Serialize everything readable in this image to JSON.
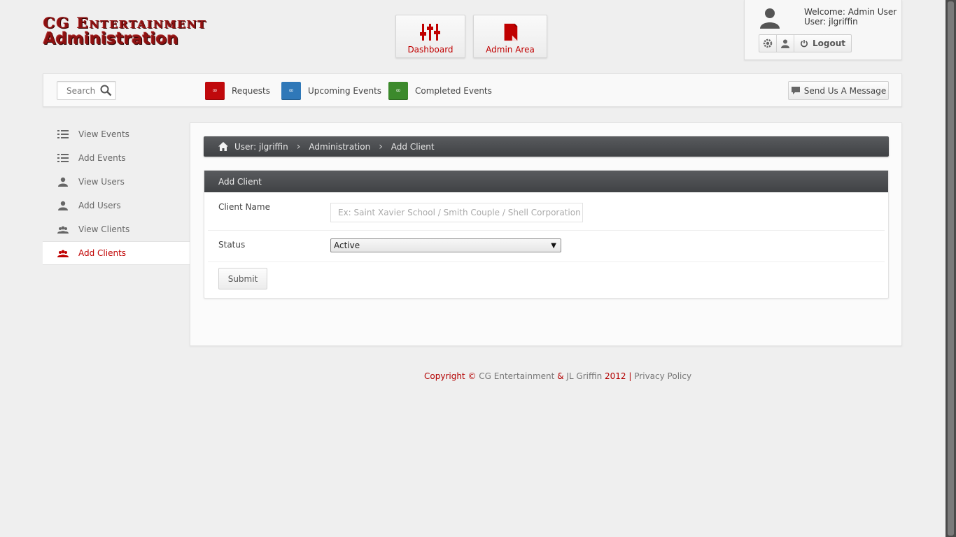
{
  "logo": {
    "top": "CG Entertainment",
    "bottom": "Administration"
  },
  "top_nav": {
    "dashboard": "Dashboard",
    "admin_area": "Admin Area"
  },
  "user": {
    "welcome": "Welcome: Admin User",
    "user_line": "User: jlgriffin",
    "logout": "Logout"
  },
  "toolbar": {
    "search_placeholder": "Search",
    "requests": "Requests",
    "upcoming": "Upcoming Events",
    "completed": "Completed Events",
    "send_message": "Send Us A Message",
    "requests_count": "∞",
    "upcoming_count": "∞",
    "completed_count": "∞",
    "colors": {
      "requests": "#c0090c",
      "upcoming": "#2f78b8",
      "completed": "#3c8a2c"
    }
  },
  "sidebar": {
    "items": [
      {
        "label": "View Events",
        "icon": "list-icon"
      },
      {
        "label": "Add Events",
        "icon": "list-icon"
      },
      {
        "label": "View Users",
        "icon": "user-icon"
      },
      {
        "label": "Add Users",
        "icon": "user-icon"
      },
      {
        "label": "View Clients",
        "icon": "group-icon"
      },
      {
        "label": "Add Clients",
        "icon": "group-icon",
        "active": true
      }
    ]
  },
  "breadcrumb": {
    "user": "User: jlgriffin",
    "section": "Administration",
    "page": "Add Client"
  },
  "form": {
    "title": "Add Client",
    "client_name_label": "Client Name",
    "client_name_placeholder": "Ex: Saint Xavier School / Smith Couple / Shell Corporation / Etc",
    "status_label": "Status",
    "status_value": "Active",
    "submit": "Submit"
  },
  "footer": {
    "copyright": "Copyright ©",
    "company": "CG Entertainment",
    "amp": "&",
    "person": "JL Griffin",
    "year": "2012",
    "sep": "|",
    "privacy": "Privacy Policy"
  },
  "accent_color": "#c00000"
}
